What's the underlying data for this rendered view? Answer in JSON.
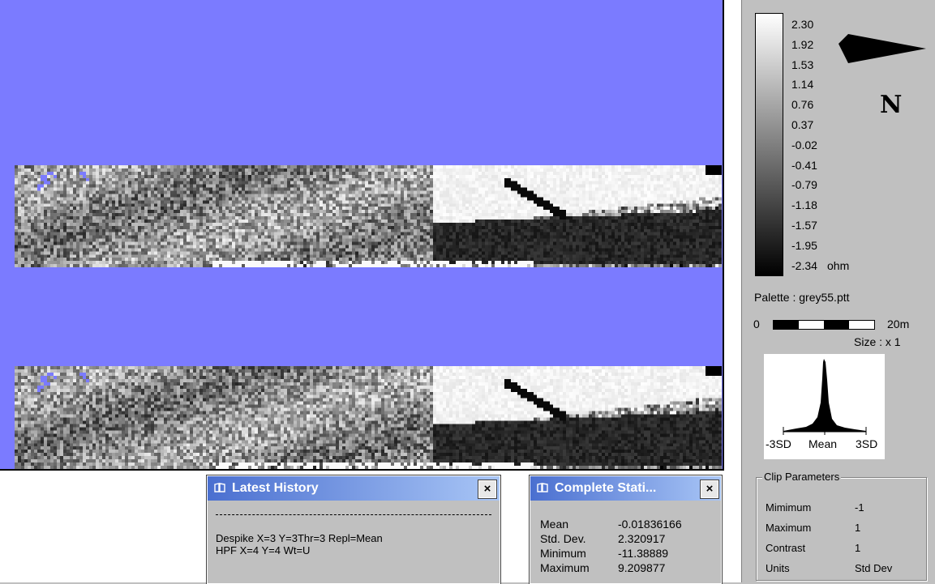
{
  "colors": {
    "plot_background": "#7b7bff",
    "titlebar_start": "#4a6fd0",
    "titlebar_end": "#a9c6f6"
  },
  "legend": {
    "ticks": [
      "2.30",
      "1.92",
      "1.53",
      "1.14",
      "0.76",
      "0.37",
      "-0.02",
      "-0.41",
      "-0.79",
      "-1.18",
      "-1.57",
      "-1.95",
      "-2.34"
    ],
    "unit": "ohm",
    "palette": "Palette : grey55.ptt"
  },
  "north": {
    "label": "N",
    "icon": "north-arrow-icon"
  },
  "scale": {
    "start": "0",
    "end": "20m",
    "size": "Size : x 1"
  },
  "histogram": {
    "left": "-3SD",
    "center": "Mean",
    "right": "3SD"
  },
  "clip_parameters": {
    "title": "Clip Parameters",
    "rows": [
      {
        "label": "Mimimum",
        "value": "-1"
      },
      {
        "label": "Maximum",
        "value": "1"
      },
      {
        "label": "Contrast",
        "value": "1"
      },
      {
        "label": "Units",
        "value": "Std Dev"
      }
    ]
  },
  "history_window": {
    "title": "Latest History",
    "separator": "------------------------------------------------------------------------",
    "lines": [
      "Despike X=3 Y=3Thr=3 Repl=Mean",
      "HPF X=4 Y=4 Wt=U"
    ],
    "close": "×"
  },
  "stats_window": {
    "title": "Complete Stati...",
    "close": "×",
    "rows": [
      {
        "label": "Mean",
        "value": "-0.01836166"
      },
      {
        "label": "Std. Dev.",
        "value": "2.320917"
      },
      {
        "label": "Minimum",
        "value": "-11.38889"
      },
      {
        "label": "Maximum",
        "value": "9.209877"
      }
    ]
  }
}
